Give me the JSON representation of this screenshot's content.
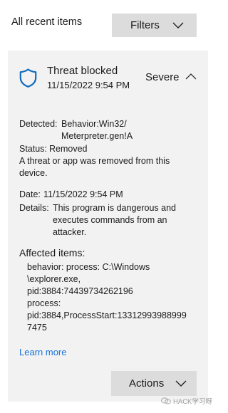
{
  "header": {
    "title": "All recent items",
    "filters_label": "Filters"
  },
  "item": {
    "title": "Threat blocked",
    "datetime": "11/15/2022 9:54 PM",
    "severity": "Severe",
    "detected_label": "Detected:",
    "detected_value_line1": "Behavior:Win32/",
    "detected_value_line2": "Meterpreter.gen!A",
    "status_label": "Status:",
    "status_value": "Removed",
    "status_message_line1": "A threat or app was removed from this",
    "status_message_line2": "device.",
    "date_label": "Date:",
    "date_value": "11/15/2022 9:54 PM",
    "details_label": "Details:",
    "details_line1": "This program is dangerous and",
    "details_line2": "executes commands from an",
    "details_line3": "attacker.",
    "affected_heading": "Affected items:",
    "affected_lines": [
      "behavior: process: C:\\Windows",
      "\\explorer.exe,",
      "pid:3884:74439734262196",
      "process:",
      "pid:3884,ProcessStart:13312993988999",
      "7475"
    ],
    "learn_more": "Learn more",
    "actions_label": "Actions"
  },
  "watermark": {
    "text": "HACK学习呀"
  },
  "colors": {
    "accent": "#1a73d9",
    "card_bg": "#f2f2f2",
    "button_bg": "#dcdcdc"
  },
  "icons": {
    "shield": "shield-icon",
    "expand": "chevron-down-icon",
    "collapse": "chevron-up-icon"
  }
}
